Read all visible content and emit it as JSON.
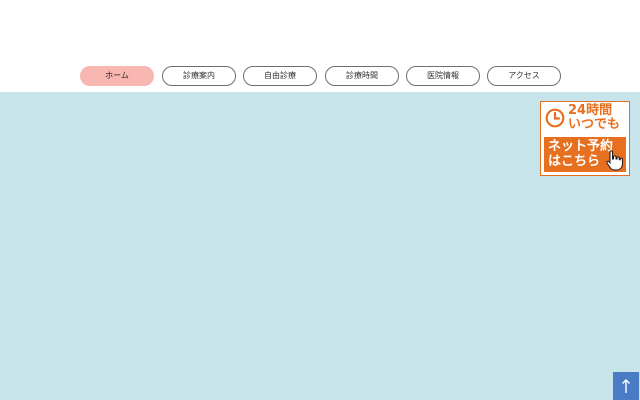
{
  "nav": {
    "items": [
      {
        "label": "ホーム",
        "active": true
      },
      {
        "label": "診療案内",
        "active": false
      },
      {
        "label": "自由診療",
        "active": false
      },
      {
        "label": "診療時間",
        "active": false
      },
      {
        "label": "医院情報",
        "active": false
      },
      {
        "label": "アクセス",
        "active": false
      }
    ]
  },
  "reserve_banner": {
    "line1": "24時間",
    "line2": "いつでも",
    "line3": "ネット予約",
    "line4": "はこちら",
    "icons": [
      "clock-icon",
      "pointing-hand-icon"
    ],
    "accent_color": "#e6701f"
  },
  "to_top": {
    "icon": "arrow-up-icon",
    "color": "#4a7cc6"
  },
  "colors": {
    "main_background": "#c6e4ea",
    "nav_active": "#f9b7b2",
    "nav_border": "#707070"
  }
}
